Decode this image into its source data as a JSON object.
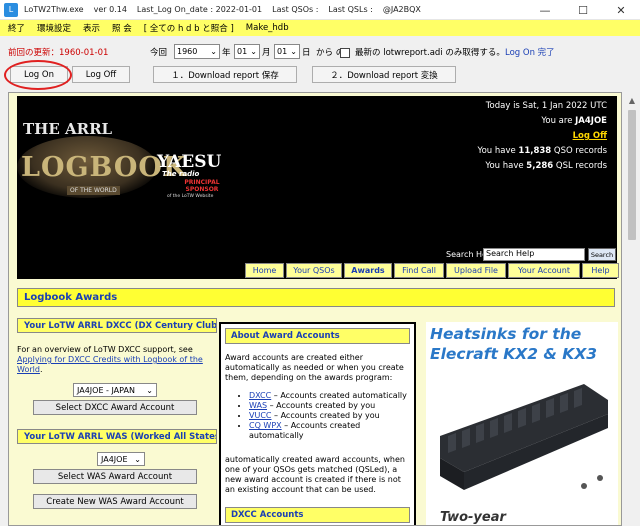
{
  "window": {
    "title_parts": [
      "LoTW2Thw.exe",
      "ver 0.14",
      "Last_Log On_date : 2022-01-01",
      "Last QSOs :",
      "Last QSLs :",
      "@JA2BQX"
    ],
    "minimize": "—",
    "maximize": "☐",
    "close": "✕"
  },
  "menu": [
    "終了",
    "環境設定",
    "表示",
    "照 会",
    "[ 全ての h d b と照合 ]",
    "Make_hdb"
  ],
  "controls": {
    "last_update_label": "前回の更新：",
    "last_update_value": "1960-01-01",
    "today_label": "今回",
    "year_value": "1960",
    "year_unit": "年",
    "month_value": "01",
    "month_unit": "月",
    "day_value": "01",
    "day_unit": "日",
    "from_label": "から の",
    "latest_label": "最新の lotwreport.adi のみ取得する。",
    "status_text": "Log On 完了",
    "log_on": "Log On",
    "log_off": "Log Off",
    "download_save": "１．Download report  保存",
    "download_convert": "２．Download report 変換"
  },
  "lotw": {
    "brand_the": "THE ARRL",
    "brand_logbook": "LOGBOOK",
    "brand_otw": "OF THE WORLD",
    "sponsor_name": "YAESU",
    "sponsor_tagline": "The radio",
    "sponsor_role": "PRINCIPAL SPONSOR",
    "sponsor_sub": "of the LoTW Website",
    "today": "Today is Sat, 1 Jan 2022 UTC",
    "you_are_prefix": "You are ",
    "callsign": "JA4JOE",
    "logoff": "Log Off",
    "qso_prefix": "You have ",
    "qso_count": "11,838",
    "qso_suffix": " QSO records",
    "qsl_prefix": "You have ",
    "qsl_count": "5,286",
    "qsl_suffix": " QSL records",
    "search_label": "Search Help:",
    "search_value": "Search Help",
    "search_button": "Search",
    "nav": [
      "Home",
      "Your QSOs",
      "Awards",
      "Find Call",
      "Upload File",
      "Your Account",
      "Help"
    ],
    "section_title": "Logbook Awards",
    "dxcc_bar": "Your LoTW ARRL DXCC (DX Century Club) Account",
    "dxcc_text_pre": "For an overview of LoTW DXCC support, see ",
    "dxcc_link": "Applying for DXCC Credits with Logbook of the World",
    "dxcc_text_post": ".",
    "dxcc_select": "JA4JOE - JAPAN",
    "dxcc_button": "Select DXCC Award Account",
    "was_bar": "Your LoTW ARRL WAS (Worked All States) Account",
    "was_select": "JA4JOE",
    "was_button": "Select WAS Award Account",
    "new_was_button": "Create New WAS Award Account",
    "about_title": "About Award Accounts",
    "about_intro": "Award accounts are created either automatically as needed or when you create them, depending on the awards program:",
    "about_items": [
      {
        "name": "DXCC",
        "text": " – Accounts created automatically"
      },
      {
        "name": "WAS",
        "text": " – Accounts created by you"
      },
      {
        "name": "VUCC",
        "text": " – Accounts created by you"
      },
      {
        "name": "CQ WPX",
        "text": " – Accounts created automatically"
      }
    ],
    "about_auto": "automatically created award accounts, when one of your QSOs gets matched (QSLed), a new award account is created if there is not an existing account that can be used.",
    "dxcc_accounts_title": "DXCC Accounts",
    "ad_title": "Heatsinks for the Elecraft KX2 & KX3",
    "ad_bottom": "Two-year"
  },
  "colors": {
    "menu_bg": "#ffff66",
    "link_blue": "#1a3fb5",
    "last_update_red": "#cc0000",
    "annotation_red": "#e02020",
    "logoff_gold": "#ffd700"
  }
}
